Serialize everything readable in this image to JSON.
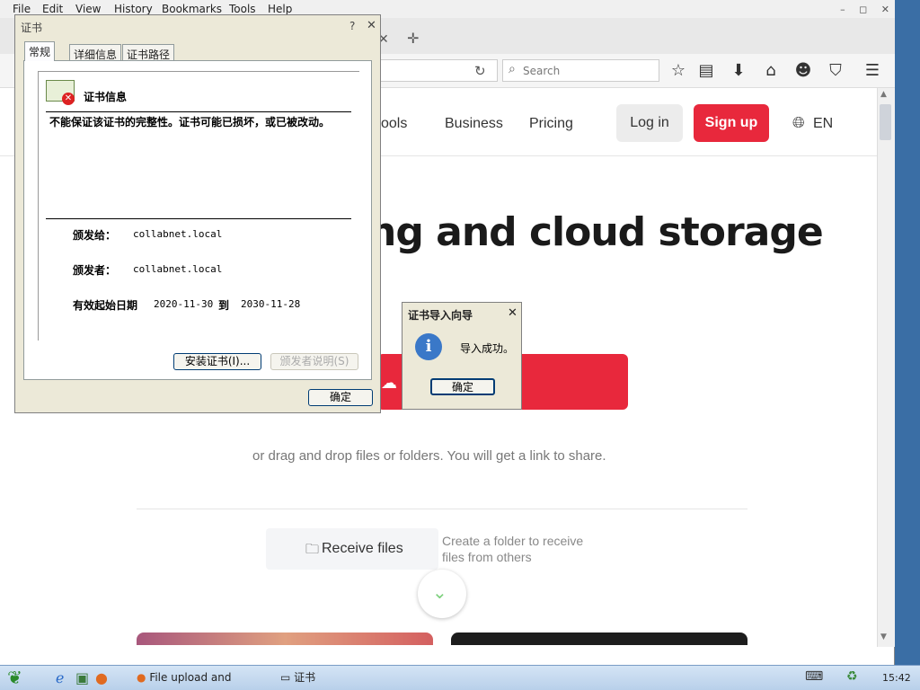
{
  "menubar": {
    "items": [
      "File",
      "Edit",
      "View",
      "History",
      "Bookmarks",
      "Tools",
      "Help"
    ]
  },
  "window_controls": {
    "minimize": "–",
    "maximize": "◻",
    "close": "✕"
  },
  "tabs": {
    "close_glyph": "✕",
    "new_tab_glyph": "✛"
  },
  "navbar": {
    "search_placeholder": "Search"
  },
  "page": {
    "nav": {
      "tools_partial": "ools",
      "business": "Business",
      "pricing": "Pricing",
      "login": "Log in",
      "signup": "Sign up",
      "lang": "EN"
    },
    "hero": "ng and cloud storage",
    "drag_text": "or drag and drop files or folders. You will get a link to share.",
    "receive": {
      "label": "Receive files",
      "desc_line1": "Create a folder to receive",
      "desc_line2": "files from others"
    }
  },
  "cert_dialog": {
    "title": "证书",
    "help": "?",
    "close": "✕",
    "tabs": [
      "常规",
      "详细信息",
      "证书路径"
    ],
    "info_title": "证书信息",
    "warning": "不能保证该证书的完整性。证书可能已损坏，或已被改动。",
    "issued_to_label": "颁发给：",
    "issued_to": "collabnet.local",
    "issued_by_label": "颁发者：",
    "issued_by": "collabnet.local",
    "valid_from_label": "有效起始日期",
    "valid_from": "2020-11-30",
    "to_label": "到",
    "valid_to": "2030-11-28",
    "install_button": "安装证书(I)...",
    "issuer_statement_button": "颁发者说明(S)",
    "ok_button": "确定"
  },
  "import_wizard": {
    "title": "证书导入向导",
    "close": "✕",
    "message": "导入成功。",
    "ok_button": "确定"
  },
  "taskbar": {
    "task_firefox": "File upload and sharin...",
    "task_cert": "证书",
    "clock": "15:42"
  },
  "colors": {
    "brand_red": "#e8283c",
    "xp_face": "#ece9d8"
  }
}
